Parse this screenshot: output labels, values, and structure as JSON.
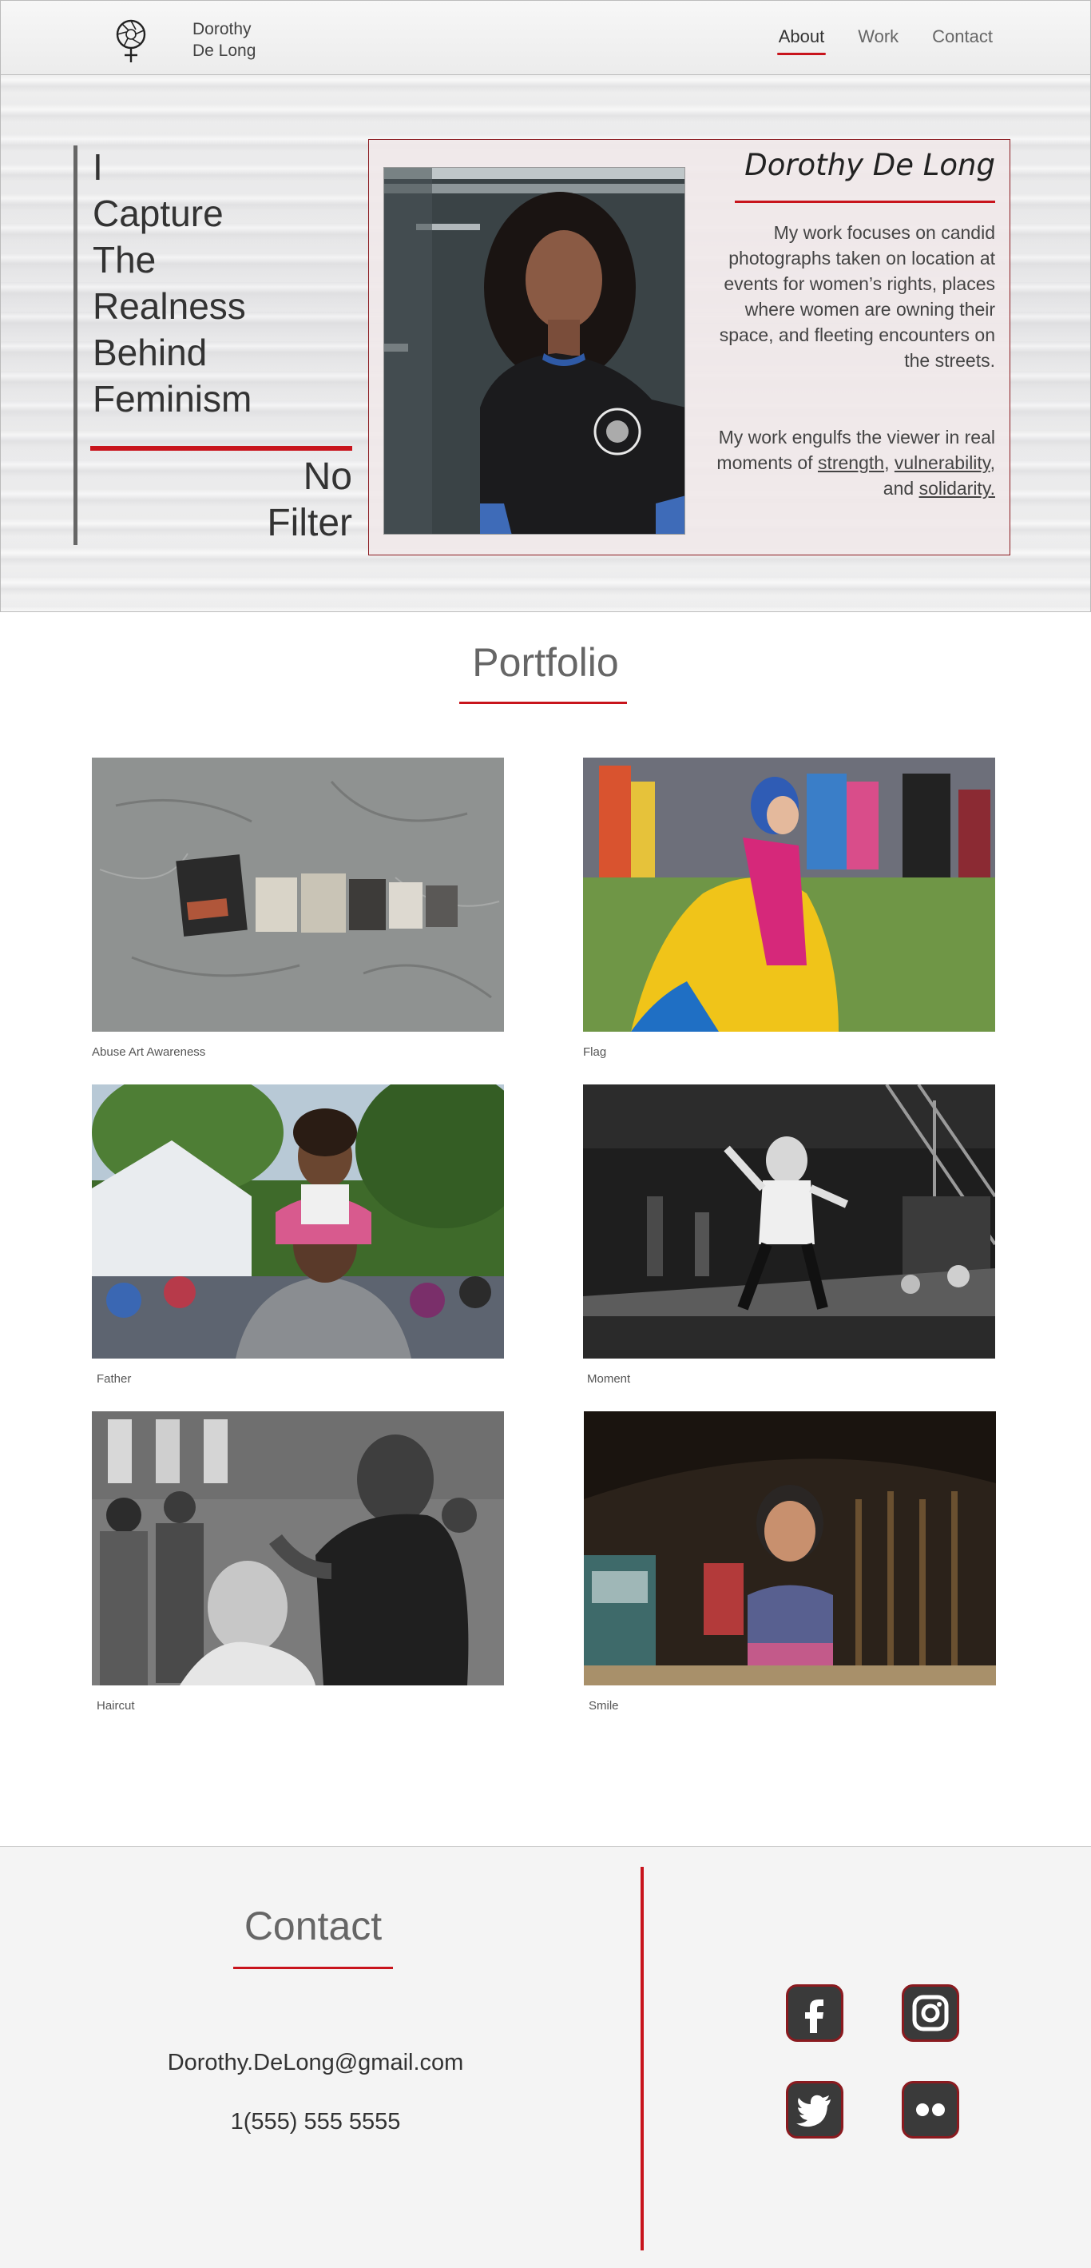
{
  "nav": {
    "brand_line1": "Dorothy",
    "brand_line2": "De Long",
    "links": [
      {
        "label": "About",
        "active": true
      },
      {
        "label": "Work",
        "active": false
      },
      {
        "label": "Contact",
        "active": false
      }
    ]
  },
  "hero": {
    "tagline": [
      "I",
      "Capture",
      "The",
      "Realness",
      "Behind",
      "Feminism"
    ],
    "subtag": [
      "No",
      "Filter"
    ],
    "name": "Dorothy De Long",
    "bio1": "My work focuses on candid photographs taken on location at events for women’s rights, places where women are owning their space, and fleeting encounters on the streets.",
    "bio2_prefix": "My work engulfs the viewer in real moments of ",
    "bio2_link1": "strength",
    "bio2_sep1": ", ",
    "bio2_link2": "vulnerability",
    "bio2_sep2": ", and ",
    "bio2_link3": "solidarity."
  },
  "portfolio": {
    "title": "Portfolio",
    "items": [
      {
        "caption": "Abuse Art Awareness"
      },
      {
        "caption": "Flag"
      },
      {
        "caption": "Father"
      },
      {
        "caption": "Moment"
      },
      {
        "caption": "Haircut"
      },
      {
        "caption": "Smile"
      }
    ]
  },
  "contact": {
    "title": "Contact",
    "email": "Dorothy.DeLong@gmail.com",
    "phone": "1(555) 555 5555",
    "social": [
      "facebook-icon",
      "instagram-icon",
      "twitter-icon",
      "flickr-icon"
    ]
  },
  "colors": {
    "accent": "#c8141c",
    "dark_red": "#8a1a1f",
    "text": "#333333"
  }
}
